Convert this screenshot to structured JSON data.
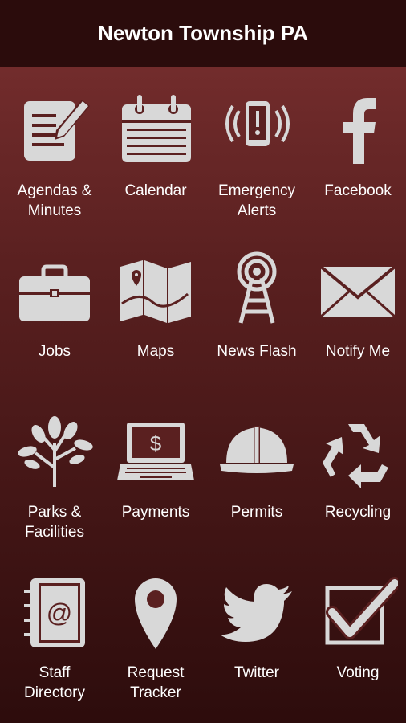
{
  "header": {
    "title": "Newton Township PA"
  },
  "tiles": [
    {
      "label": "Agendas &\nMinutes",
      "icon": "document-pencil-icon"
    },
    {
      "label": "Calendar",
      "icon": "calendar-icon"
    },
    {
      "label": "Emergency\nAlerts",
      "icon": "phone-alert-icon"
    },
    {
      "label": "Facebook",
      "icon": "facebook-icon"
    },
    {
      "label": "Jobs",
      "icon": "briefcase-icon"
    },
    {
      "label": "Maps",
      "icon": "map-icon"
    },
    {
      "label": "News Flash",
      "icon": "broadcast-tower-icon"
    },
    {
      "label": "Notify Me",
      "icon": "envelope-icon"
    },
    {
      "label": "Parks &\nFacilities",
      "icon": "tree-icon"
    },
    {
      "label": "Payments",
      "icon": "laptop-dollar-icon"
    },
    {
      "label": "Permits",
      "icon": "hard-hat-icon"
    },
    {
      "label": "Recycling",
      "icon": "recycle-icon"
    },
    {
      "label": "Staff\nDirectory",
      "icon": "address-book-icon"
    },
    {
      "label": "Request\nTracker",
      "icon": "location-pin-icon"
    },
    {
      "label": "Twitter",
      "icon": "twitter-bird-icon"
    },
    {
      "label": "Voting",
      "icon": "checkbox-icon"
    }
  ],
  "colors": {
    "header_bg": "#2b0c0c",
    "icon": "#d8d8d8",
    "text": "#ffffff"
  }
}
